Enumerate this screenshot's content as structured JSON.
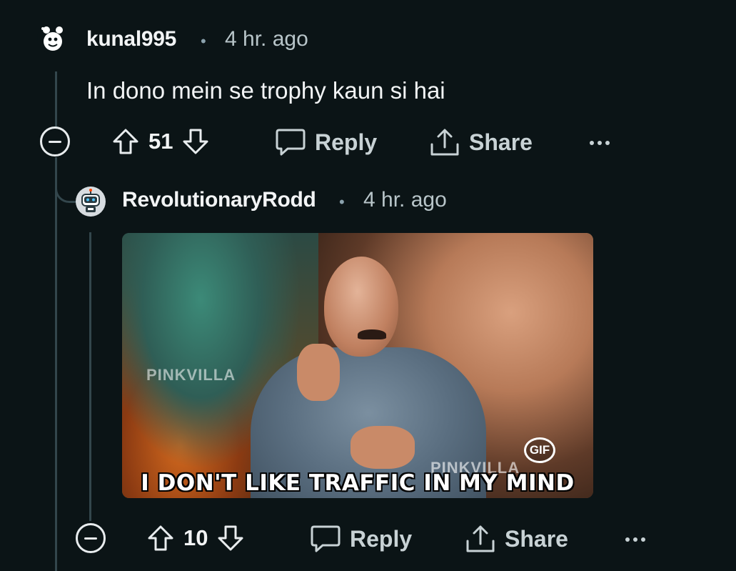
{
  "comment1": {
    "username": "kunal995",
    "separator": "•",
    "time": "4 hr. ago",
    "body": "In dono mein se trophy kaun si hai",
    "score": "51",
    "reply_label": "Reply",
    "share_label": "Share"
  },
  "comment2": {
    "username": "RevolutionaryRodd",
    "separator": "•",
    "time": "4 hr. ago",
    "gif": {
      "watermark_left": "PINKVILLA",
      "watermark_right": "PINKVILLA",
      "caption": "I DON'T LIKE TRAFFIC IN MY MIND",
      "badge": "GIF"
    },
    "score": "10",
    "reply_label": "Reply",
    "share_label": "Share"
  },
  "colors": {
    "background": "#0b1416",
    "text": "#f2f4f5",
    "muted": "#b8c5c9",
    "thread_line": "#33464c"
  },
  "icons": {
    "upvote": "arrow-up-icon",
    "downvote": "arrow-down-icon",
    "reply": "speech-bubble-icon",
    "share": "share-icon",
    "more": "ellipsis-icon",
    "collapse": "minus-circle-icon"
  }
}
